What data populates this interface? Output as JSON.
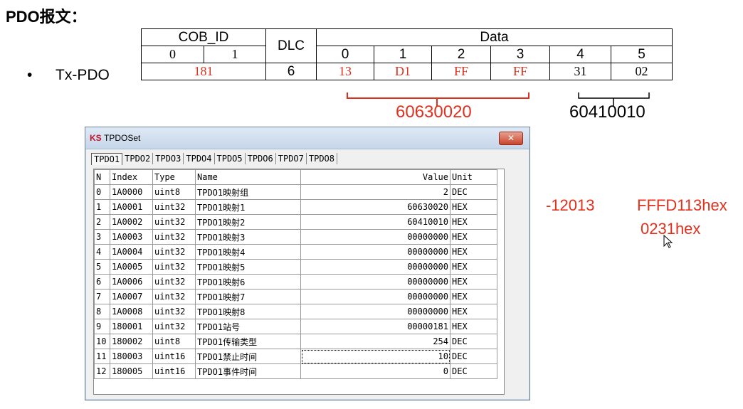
{
  "slide": {
    "title": "PDO报文："
  },
  "bullet": {
    "marker": "•",
    "label": "Tx-PDO"
  },
  "frame": {
    "cob_id_header": "COB_ID",
    "dlc_header": "DLC",
    "data_header": "Data",
    "cob_sub": [
      "0",
      "1"
    ],
    "data_sub": [
      "0",
      "1",
      "2",
      "3",
      "4",
      "5"
    ],
    "cob_value": "181",
    "dlc_value": "6",
    "data_values": [
      "13",
      "D1",
      "FF",
      "FF",
      "31",
      "02"
    ]
  },
  "braces": {
    "left_label": "60630020",
    "right_label": "60410010"
  },
  "window": {
    "icon": "KS",
    "title": "TPDOSet",
    "close_label": "✕",
    "tabs": [
      "TPDO1",
      "TPDO2",
      "TPDO3",
      "TPDO4",
      "TPDO5",
      "TPDO6",
      "TPDO7",
      "TPDO8"
    ],
    "active_tab": 0,
    "columns": [
      "N",
      "Index",
      "Type",
      "Name",
      "Value",
      "Unit"
    ],
    "rows": [
      [
        "0",
        "1A0000",
        "uint8",
        "TPDO1映射组",
        "2",
        "DEC"
      ],
      [
        "1",
        "1A0001",
        "uint32",
        "TPDO1映射1",
        "60630020",
        "HEX"
      ],
      [
        "2",
        "1A0002",
        "uint32",
        "TPDO1映射2",
        "60410010",
        "HEX"
      ],
      [
        "3",
        "1A0003",
        "uint32",
        "TPDO1映射3",
        "00000000",
        "HEX"
      ],
      [
        "4",
        "1A0004",
        "uint32",
        "TPDO1映射4",
        "00000000",
        "HEX"
      ],
      [
        "5",
        "1A0005",
        "uint32",
        "TPDO1映射5",
        "00000000",
        "HEX"
      ],
      [
        "6",
        "1A0006",
        "uint32",
        "TPDO1映射6",
        "00000000",
        "HEX"
      ],
      [
        "7",
        "1A0007",
        "uint32",
        "TPDO1映射7",
        "00000000",
        "HEX"
      ],
      [
        "8",
        "1A0008",
        "uint32",
        "TPDO1映射8",
        "00000000",
        "HEX"
      ],
      [
        "9",
        "180001",
        "uint32",
        "TPDO1站号",
        "00000181",
        "HEX"
      ],
      [
        "10",
        "180002",
        "uint8",
        "TPDO1传输类型",
        "254",
        "DEC"
      ],
      [
        "11",
        "180003",
        "uint16",
        "TPDO1禁止时间",
        "10",
        "DEC"
      ],
      [
        "12",
        "180005",
        "uint16",
        "TPDO1事件时间",
        "0",
        "DEC"
      ]
    ]
  },
  "annotations": {
    "neg": "-12013",
    "hex1": "FFFD113hex",
    "hex2": "0231hex"
  },
  "colors": {
    "red": "#e0301e",
    "black": "#000000"
  }
}
